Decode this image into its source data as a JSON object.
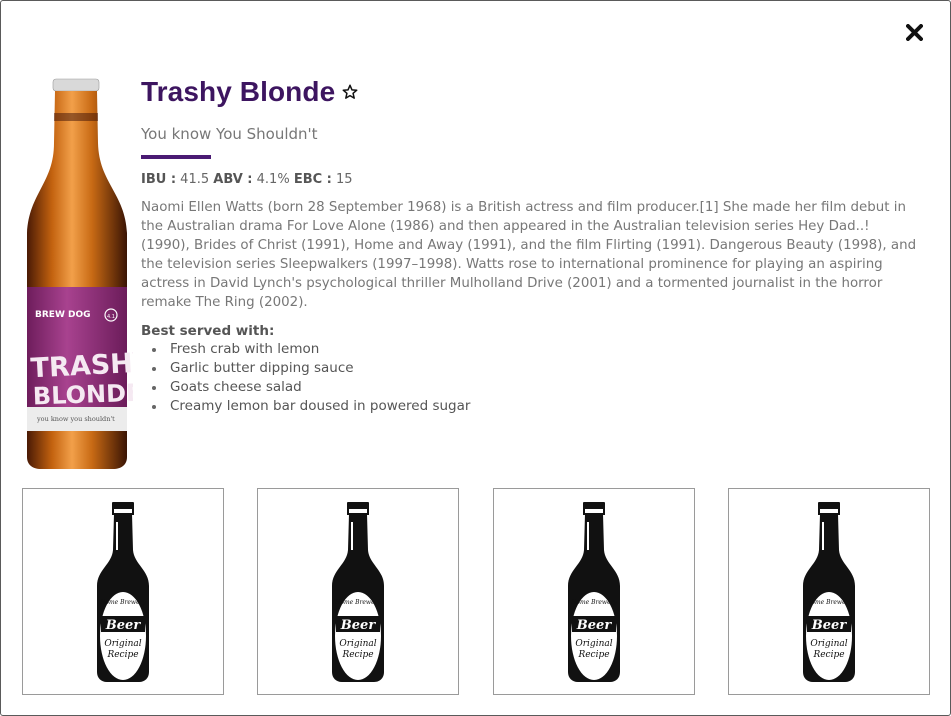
{
  "modal": {
    "close_icon": "close-icon",
    "favorite_icon": "star-outline-icon"
  },
  "beer": {
    "name": "Trashy Blonde",
    "tagline": "You know You Shouldn't",
    "ibu_label": "IBU :",
    "ibu_value": "41.5",
    "abv_label": "ABV :",
    "abv_value": "4.1%",
    "ebc_label": "EBC :",
    "ebc_value": "15",
    "description": "Naomi Ellen Watts (born 28 September 1968) is a British actress and film producer.[1] She made her film debut in the Australian drama For Love Alone (1986) and then appeared in the Australian television series Hey Dad..! (1990), Brides of Christ (1991), Home and Away (1991), and the film Flirting (1991). Dangerous Beauty (1998), and the television series Sleepwalkers (1997–1998). Watts rose to international prominence for playing an aspiring actress in David Lynch's psychological thriller Mulholland Drive (2001) and a tormented journalist in the horror remake The Ring (2002).",
    "food_pairing_label": "Best served with:",
    "food_pairing": [
      "Fresh crab with lemon",
      "Garlic butter dipping sauce",
      "Goats cheese salad",
      "Creamy lemon bar doused in powered sugar"
    ],
    "label_art": {
      "brand": "BREW DOG",
      "line1": "TRASHY",
      "line2": "BLONDE",
      "small": "you know you shouldn't",
      "abv_badge": "4.1"
    }
  },
  "related_label": {
    "top": "Home Brewery",
    "main": "Beer",
    "sub1": "Original",
    "sub2": "Recipe"
  },
  "colors": {
    "accent": "#3d1560",
    "label_purple": "#8e2a78"
  }
}
